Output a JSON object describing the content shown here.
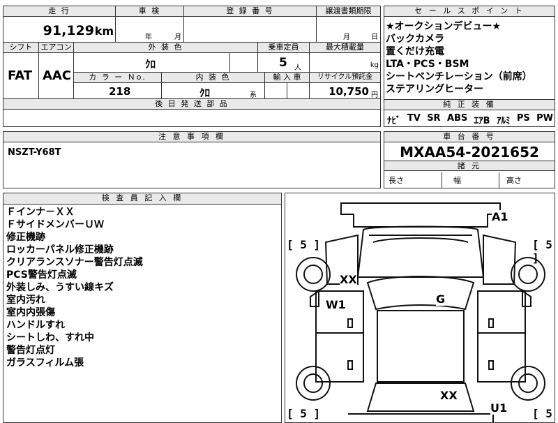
{
  "top": {
    "mileage_label": "走 行",
    "mileage_value": "91,129",
    "mileage_unit": "km",
    "shaken_label": "車 検",
    "shaken_year": "年",
    "shaken_month": "月",
    "reg_label": "登 録 番 号",
    "transfer_label": "譲渡書類期限",
    "transfer_month": "月",
    "transfer_day": "日",
    "shift_label": "シフト",
    "shift_value": "FAT",
    "aircon_label": "エアコン",
    "aircon_value": "AAC",
    "exterior_label": "外 装 色",
    "exterior_value": "ｸﾛ",
    "capacity_label": "乗車定員",
    "capacity_value": "5",
    "capacity_unit": "人",
    "load_label": "最大積載量",
    "load_unit": "kg",
    "colorno_label": "カ ラ ー Ｎo.",
    "colorno_value": "218",
    "interior_label": "内 装 色",
    "interior_value": "ｸﾛ",
    "interior_suffix": "系",
    "import_label": "輸 入 車",
    "recycle_label": "リサイクル預託金",
    "recycle_value": "10,750",
    "recycle_unit": "円",
    "later_label": "後 日 発 送 部 品"
  },
  "sales": {
    "label": "セ ー ル ス ポ イ ン ト",
    "lines": [
      "★オークションデビュー★",
      "バックカメラ",
      "置くだけ充電",
      "LTA・PCS・BSM",
      "シートベンチレーション（前席）",
      "ステアリングヒーター"
    ],
    "equip_label": "純 正 装 備",
    "equip_items": [
      "ﾅﾋﾞ",
      "TV",
      "SR",
      "ABS",
      "ｴｱB",
      "ｱﾙﾐ",
      "PS",
      "PW"
    ]
  },
  "notes": {
    "label": "注 意 事 項 欄",
    "text": "NSZT-Y68T"
  },
  "chassis": {
    "label": "車 台 番 号",
    "value": "MXAA54-2021652",
    "dims_label": "諸 元",
    "length": "長さ",
    "width": "幅",
    "height": "高さ"
  },
  "inspector": {
    "label": "検 査 員 記 入 欄",
    "lines": [
      "Ｆインナ－ＸＸ",
      "ＦサイドメンバーＵＷ",
      "修正機跡",
      "ロッカーパネル修正機跡",
      "クリアランスソナー警告灯点滅",
      "PCS警告灯点滅",
      "外装しみ、うすい線キズ",
      "室内汚れ",
      "室内内張傷",
      "ハンドルすれ",
      "シートしわ、すれ中",
      "警告灯点灯",
      "ガラスフィルム張"
    ]
  },
  "diagram": {
    "marks": [
      "A1",
      "XX",
      "W1",
      "G",
      "XX",
      "U1"
    ],
    "tires": [
      "5",
      "5",
      "5",
      "5"
    ]
  }
}
